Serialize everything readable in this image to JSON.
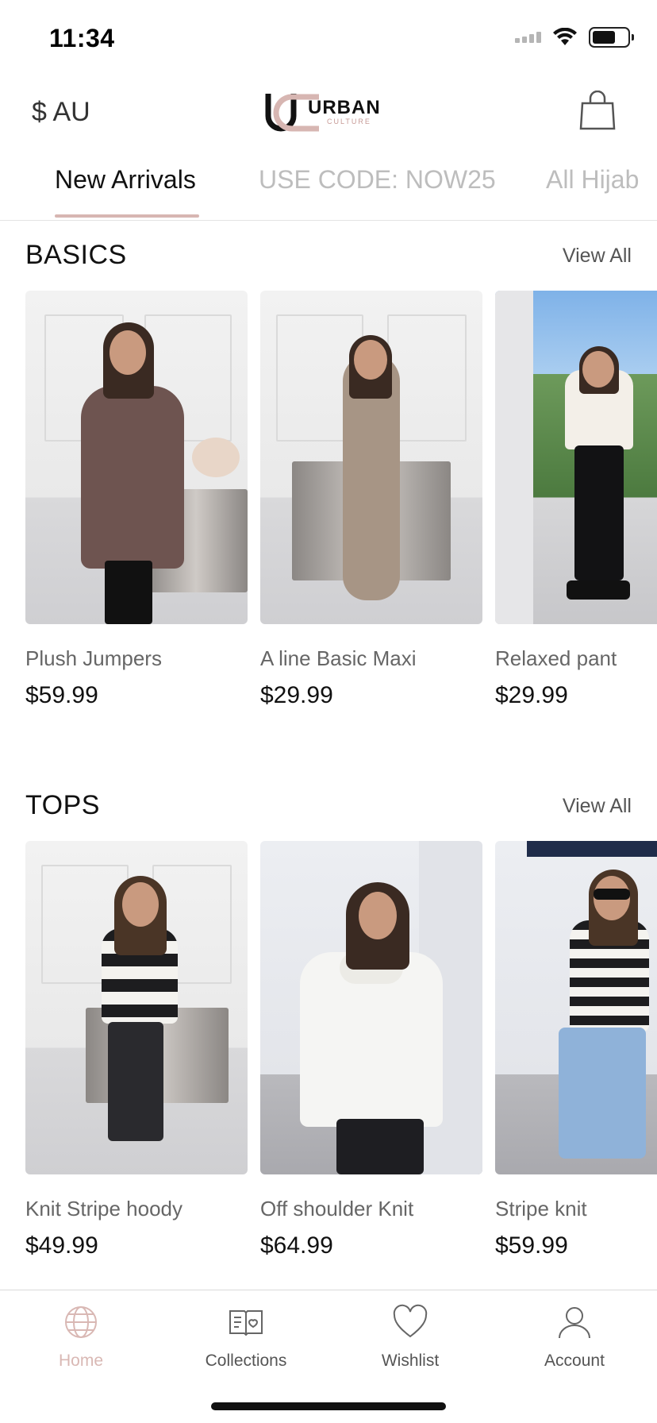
{
  "status_bar": {
    "time": "11:34"
  },
  "header": {
    "currency": "$ AU",
    "logo_word": "URBAN",
    "logo_sub": "CULTURE"
  },
  "tabs": [
    {
      "label": "New Arrivals",
      "active": true
    },
    {
      "label": "USE CODE: NOW25",
      "active": false
    },
    {
      "label": "All Hijab",
      "active": false
    }
  ],
  "sections": [
    {
      "title": "BASICS",
      "view_all": "View All",
      "products": [
        {
          "name": "Plush Jumpers",
          "price": "$59.99"
        },
        {
          "name": "A line Basic Maxi",
          "price": "$29.99"
        },
        {
          "name": "Relaxed pant",
          "price": "$29.99"
        }
      ]
    },
    {
      "title": "TOPS",
      "view_all": "View All",
      "products": [
        {
          "name": "Knit Stripe hoody",
          "price": "$49.99"
        },
        {
          "name": "Off shoulder Knit",
          "price": "$64.99"
        },
        {
          "name": "Stripe knit",
          "price": "$59.99"
        }
      ]
    }
  ],
  "bottom_nav": [
    {
      "label": "Home",
      "icon": "globe-icon",
      "active": true
    },
    {
      "label": "Collections",
      "icon": "book-icon",
      "active": false
    },
    {
      "label": "Wishlist",
      "icon": "heart-icon",
      "active": false
    },
    {
      "label": "Account",
      "icon": "user-icon",
      "active": false
    }
  ],
  "colors": {
    "accent": "#d7b6b2",
    "inactive_tab": "#bdbdbd",
    "text": "#111111"
  }
}
